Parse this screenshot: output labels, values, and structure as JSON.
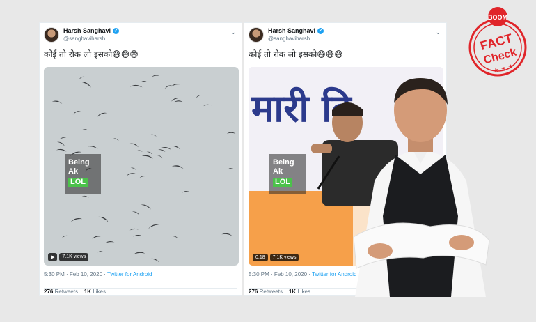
{
  "tweets": [
    {
      "name": "Harsh Sanghavi",
      "handle": "@sanghaviharsh",
      "text": "कोई तो रोक लो इसको😅😅😅",
      "timestamp": "5:30 PM · Feb 10, 2020 · ",
      "source": "Twitter for Android",
      "retweets": "276",
      "retweets_label": "Retweets",
      "likes": "1K",
      "likes_label": "Likes",
      "views": "7.1K views",
      "duration": "",
      "watermark_1": "Being",
      "watermark_2": "Ak",
      "watermark_3": "LOL"
    },
    {
      "name": "Harsh Sanghavi",
      "handle": "@sanghaviharsh",
      "text": "कोई तो रोक लो इसको😅😅😅",
      "timestamp": "5:30 PM · Feb 10, 2020 · ",
      "source": "Twitter for Android",
      "retweets": "276",
      "retweets_label": "Retweets",
      "likes": "1K",
      "likes_label": "Likes",
      "views": "7.1K views",
      "duration": "0:18",
      "watermark_1": "Being",
      "watermark_2": "Ak",
      "watermark_3": "LOL",
      "banner_text": "मारी दि"
    }
  ],
  "stamp": {
    "top": "BOOM",
    "line1": "FACT",
    "line2": "Check"
  },
  "colors": {
    "stamp": "#e0252a",
    "twitter_blue": "#1da1f2",
    "congress_orange": "#f4821f"
  }
}
